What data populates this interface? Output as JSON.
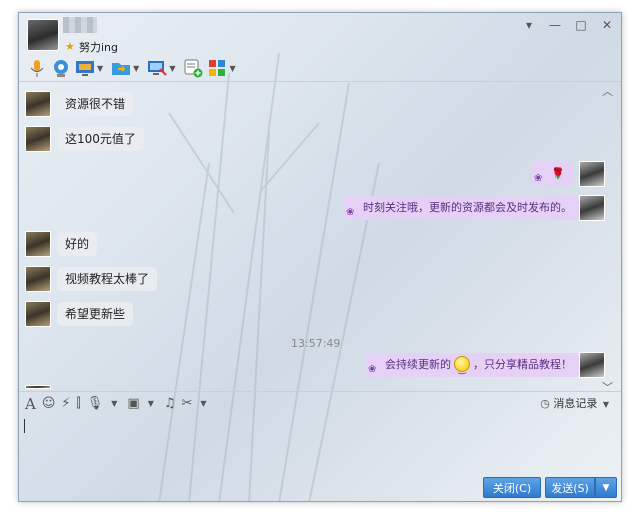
{
  "header": {
    "signature": "努力ing"
  },
  "window_controls": [
    "▾",
    "—",
    "□",
    "✕"
  ],
  "toolbar": {
    "icons": [
      "mic-icon",
      "webcam-icon",
      "screen-share-icon",
      "file-transfer-icon",
      "remote-assist-icon",
      "create-group-icon",
      "apps-icon"
    ]
  },
  "messages": [
    {
      "side": "left",
      "text": "资源很不错"
    },
    {
      "side": "left",
      "text": "这100元值了"
    },
    {
      "side": "right",
      "text": "🌹"
    },
    {
      "side": "right",
      "text": "时刻关注哦，更新的资源都会及时发布的。"
    },
    {
      "side": "left",
      "text": "好的"
    },
    {
      "side": "left",
      "text": "视频教程太棒了"
    },
    {
      "side": "left",
      "text": "希望更新些"
    },
    {
      "side": "right",
      "text_before": "会持续更新的",
      "text_after": "，只分享精品教程！"
    }
  ],
  "timestamp": "13:57:49",
  "input_toolbar": {
    "history_label": "消息记录"
  },
  "buttons": {
    "close": "关闭(C)",
    "send": "发送(S)"
  },
  "colors": {
    "accent": "#3d86d6",
    "bubble_right": "#e6d0f6",
    "bubble_right_text": "#5b2c82"
  }
}
